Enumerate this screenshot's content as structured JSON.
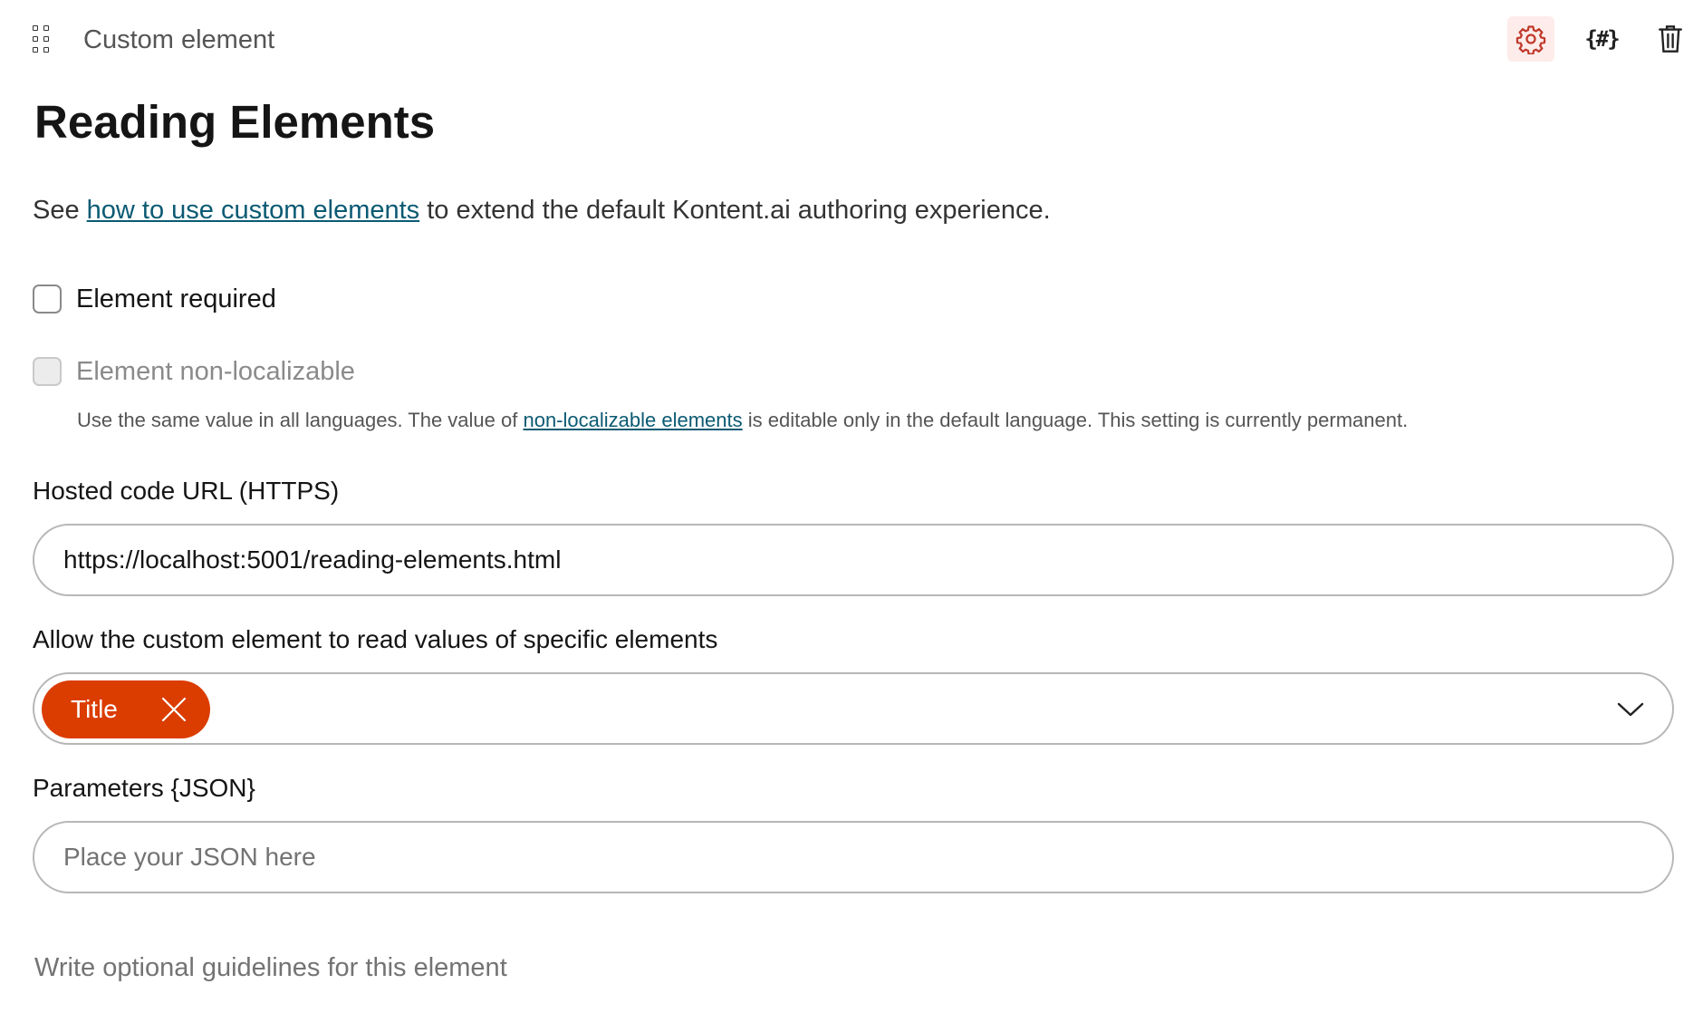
{
  "header": {
    "element_type": "Custom element",
    "icons": [
      "drag-handle-icon",
      "gear-icon",
      "json-codename-icon",
      "trash-icon"
    ]
  },
  "title": "Reading Elements",
  "intro": {
    "prefix": "See ",
    "link": "how to use custom elements",
    "suffix": " to extend the default Kontent.ai authoring experience."
  },
  "options": {
    "required_label": "Element required",
    "required_checked": false,
    "nonlocalizable_label": "Element non-localizable",
    "nonlocalizable_disabled": true,
    "hint_prefix": "Use the same value in all languages. The value of ",
    "hint_link": "non-localizable elements",
    "hint_suffix": " is editable only in the default language. This setting is currently permanent."
  },
  "hosted_url": {
    "label": "Hosted code URL (HTTPS)",
    "value": "https://localhost:5001/reading-elements.html"
  },
  "allowed_elements": {
    "label": "Allow the custom element to read values of specific elements",
    "tags": [
      "Title"
    ]
  },
  "parameters": {
    "label": "Parameters {JSON}",
    "placeholder": "Place your JSON here"
  },
  "guidelines_placeholder": "Write optional guidelines for this element",
  "colors": {
    "accent": "#db3c00",
    "link": "#0b5a73",
    "active_icon_bg": "#fdecea"
  }
}
